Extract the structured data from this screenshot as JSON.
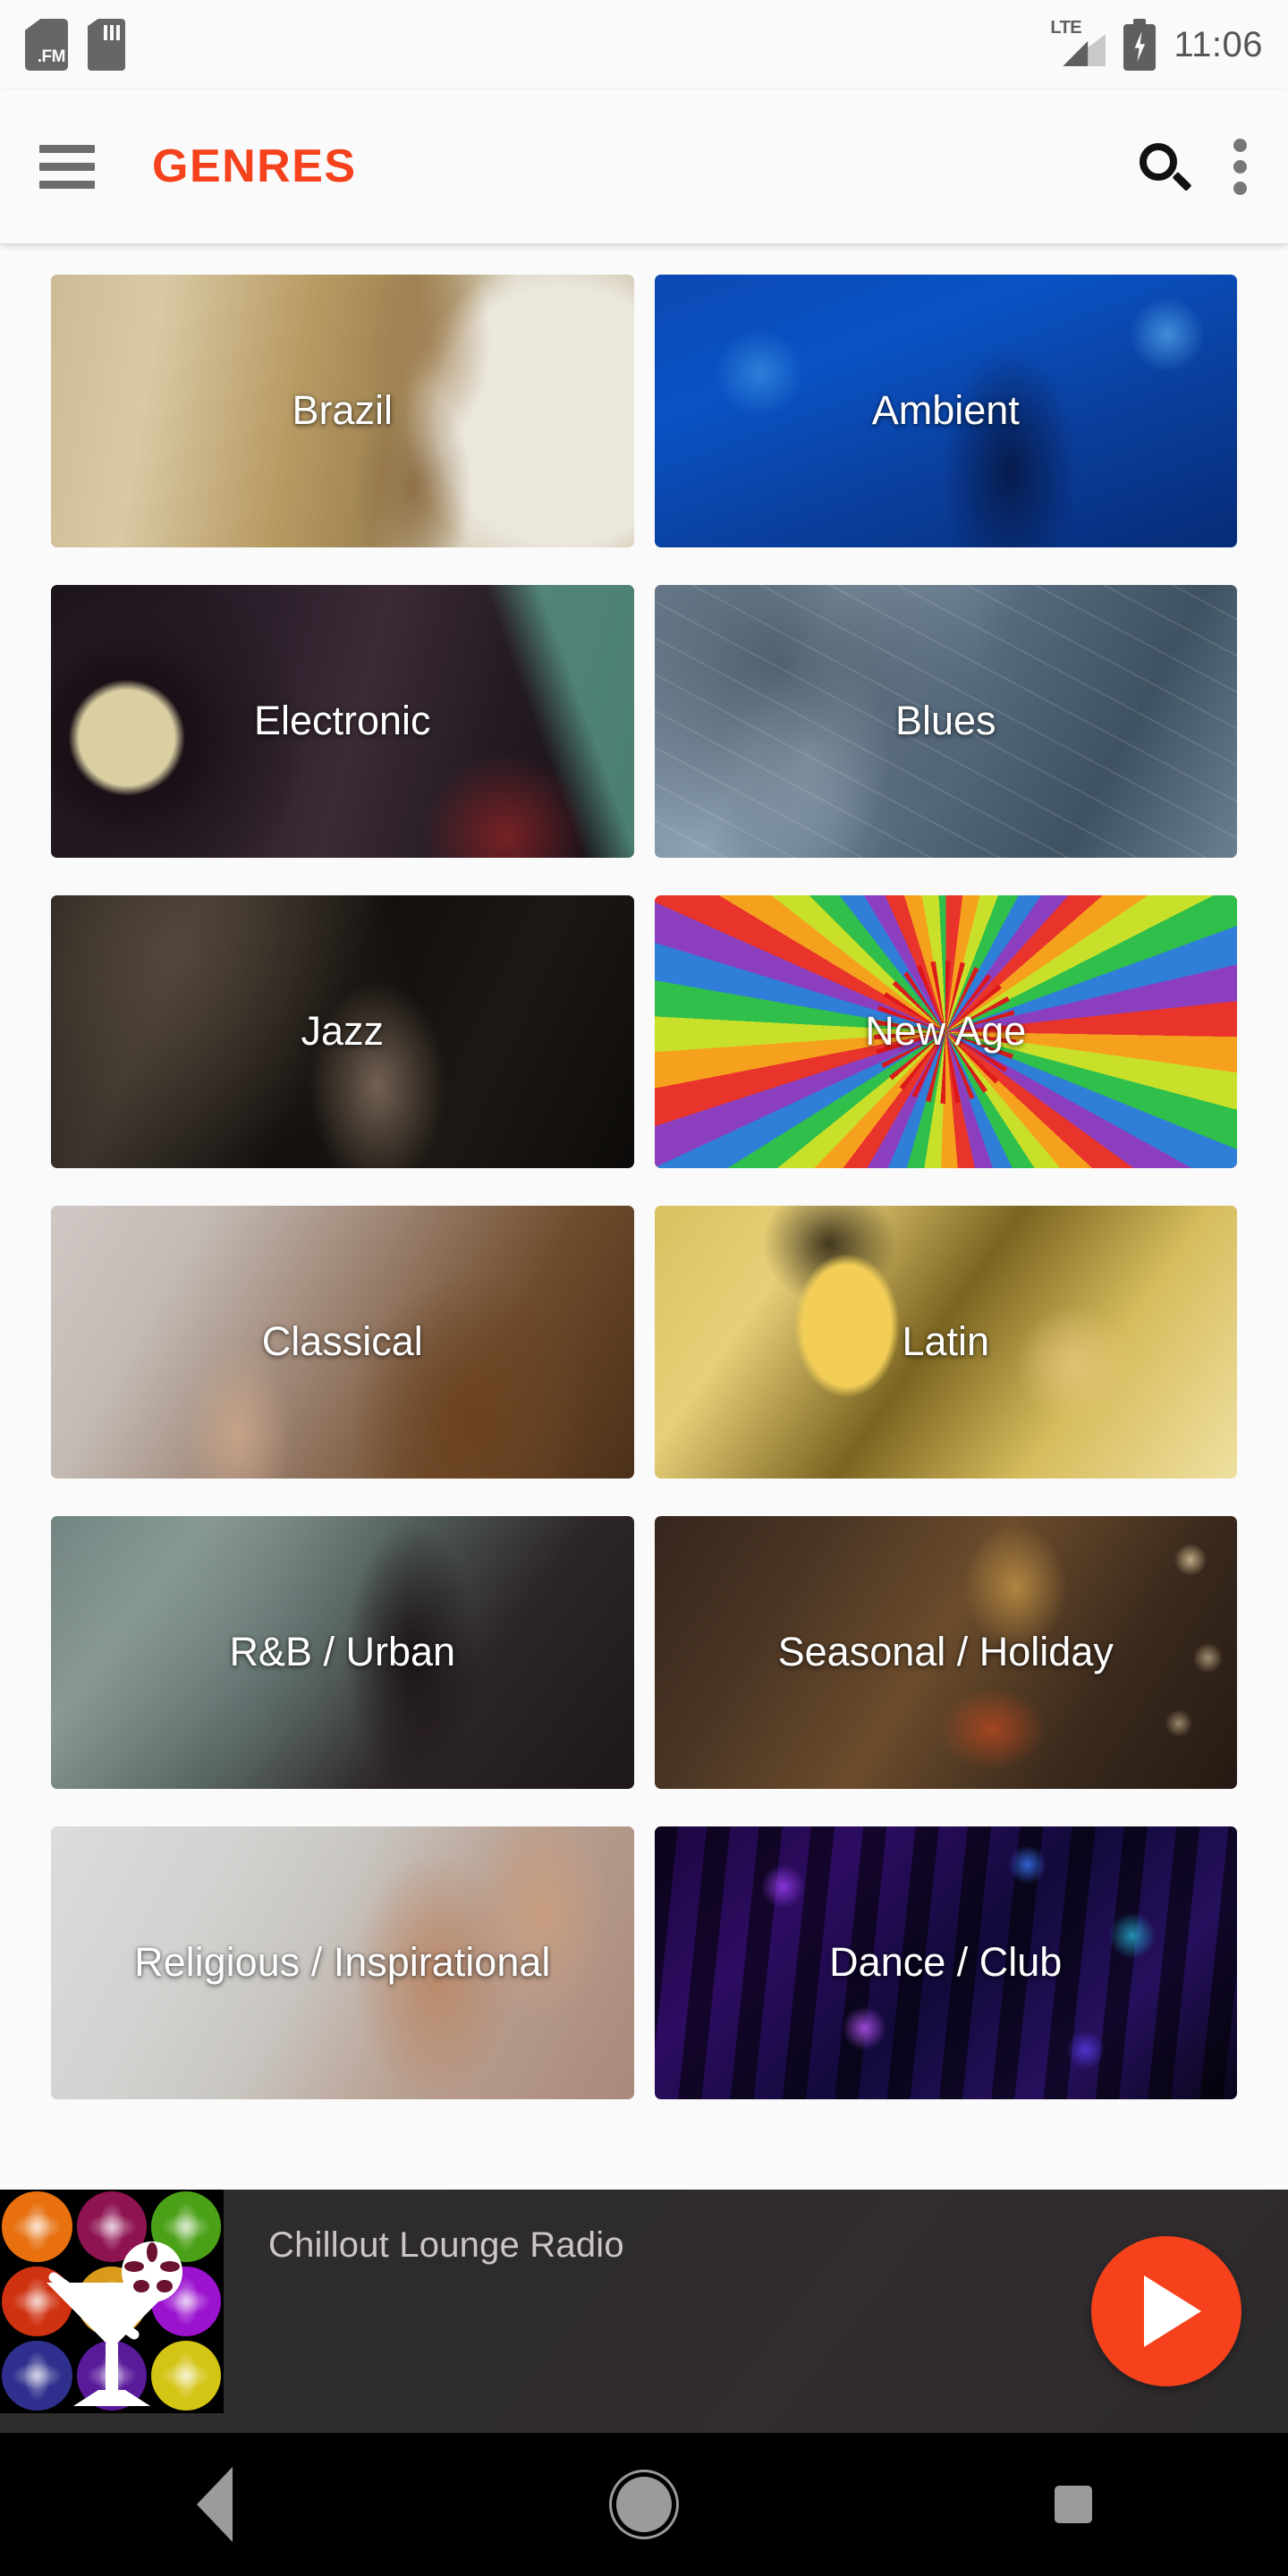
{
  "status_bar": {
    "time": "11:06",
    "notification_icon": "fm-notification-icon",
    "fm_label": ".FM",
    "sim_icon": "sim-card-icon",
    "network_type": "LTE",
    "signal_icon": "signal-bars-icon",
    "battery_icon": "battery-charging-icon"
  },
  "app_bar": {
    "menu_icon": "hamburger-menu-icon",
    "title": "GENRES",
    "title_color": "#f5421c",
    "search_icon": "search-icon",
    "overflow_icon": "more-vertical-icon"
  },
  "genres": [
    {
      "label": "Brazil",
      "art": "art-brazil"
    },
    {
      "label": "Ambient",
      "art": "art-ambient"
    },
    {
      "label": "Electronic",
      "art": "art-electronic"
    },
    {
      "label": "Blues",
      "art": "art-blues"
    },
    {
      "label": "Jazz",
      "art": "art-jazz"
    },
    {
      "label": "New Age",
      "art": "art-newage"
    },
    {
      "label": "Classical",
      "art": "art-classical"
    },
    {
      "label": "Latin",
      "art": "art-latin"
    },
    {
      "label": "R&B / Urban",
      "art": "art-rnb"
    },
    {
      "label": "Seasonal / Holiday",
      "art": "art-seasonal"
    },
    {
      "label": "Religious / Inspirational",
      "art": "art-religious"
    },
    {
      "label": "Dance / Club",
      "art": "art-dance"
    }
  ],
  "player": {
    "station_title": "Chillout Lounge Radio",
    "album_art_icon": "cocktail-glass-album-art",
    "play_icon": "play-icon",
    "play_button_color": "#f5421c",
    "album_dot_colors": [
      "#e8700f",
      "#8e1351",
      "#4aa016",
      "#cf3211",
      "#d9991a",
      "#9b12cf",
      "#2f2f8e",
      "#5a1b9b",
      "#d4c413"
    ]
  },
  "nav_bar": {
    "back_icon": "back-triangle-icon",
    "home_icon": "home-circle-icon",
    "recents_icon": "recents-square-icon"
  }
}
